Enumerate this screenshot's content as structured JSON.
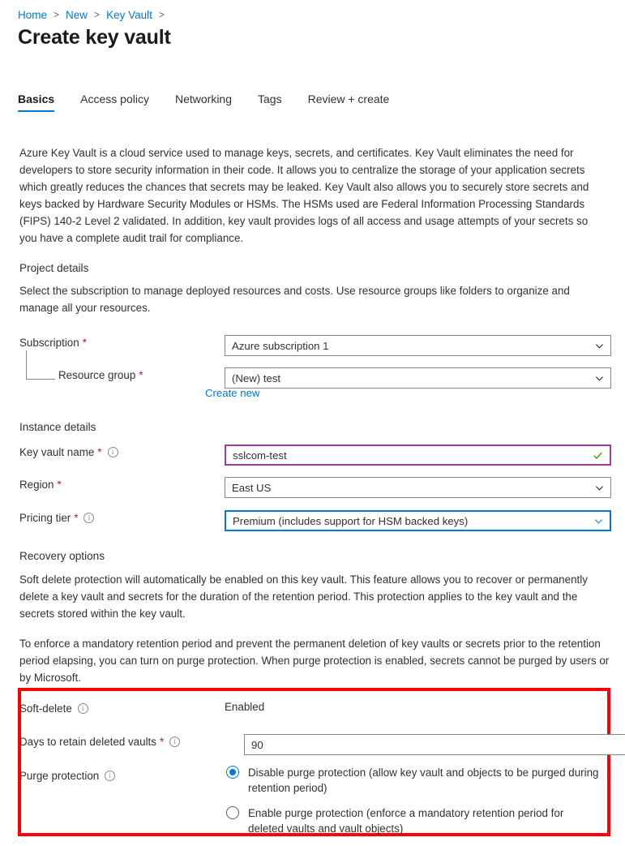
{
  "breadcrumb": {
    "items": [
      "Home",
      "New",
      "Key Vault"
    ],
    "separator": ">"
  },
  "page_title": "Create key vault",
  "tabs": [
    {
      "label": "Basics",
      "active": true
    },
    {
      "label": "Access policy",
      "active": false
    },
    {
      "label": "Networking",
      "active": false
    },
    {
      "label": "Tags",
      "active": false
    },
    {
      "label": "Review + create",
      "active": false
    }
  ],
  "intro": "Azure Key Vault is a cloud service used to manage keys, secrets, and certificates. Key Vault eliminates the need for developers to store security information in their code. It allows you to centralize the storage of your application secrets which greatly reduces the chances that secrets may be leaked. Key Vault also allows you to securely store secrets and keys backed by Hardware Security Modules or HSMs. The HSMs used are Federal Information Processing Standards (FIPS) 140-2 Level 2 validated. In addition, key vault provides logs of all access and usage attempts of your secrets so you have a complete audit trail for compliance.",
  "project_details": {
    "heading": "Project details",
    "description": "Select the subscription to manage deployed resources and costs. Use resource groups like folders to organize and manage all your resources.",
    "subscription": {
      "label": "Subscription",
      "required": "*",
      "value": "Azure subscription 1"
    },
    "resource_group": {
      "label": "Resource group",
      "required": "*",
      "value": "(New) test",
      "create_new_link": "Create new"
    }
  },
  "instance_details": {
    "heading": "Instance details",
    "key_vault_name": {
      "label": "Key vault name",
      "required": "*",
      "value": "sslcom-test"
    },
    "region": {
      "label": "Region",
      "required": "*",
      "value": "East US"
    },
    "pricing_tier": {
      "label": "Pricing tier",
      "required": "*",
      "value": "Premium (includes support for HSM backed keys)"
    }
  },
  "recovery_options": {
    "heading": "Recovery options",
    "paragraph1": "Soft delete protection will automatically be enabled on this key vault. This feature allows you to recover or permanently delete a key vault and secrets for the duration of the retention period. This protection applies to the key vault and the secrets stored within the key vault.",
    "paragraph2": "To enforce a mandatory retention period and prevent the permanent deletion of key vaults or secrets prior to the retention period elapsing, you can turn on purge protection. When purge protection is enabled, secrets cannot be purged by users or by Microsoft.",
    "soft_delete": {
      "label": "Soft-delete",
      "value": "Enabled"
    },
    "days_to_retain": {
      "label": "Days to retain deleted vaults",
      "required": "*",
      "value": "90"
    },
    "purge_protection": {
      "label": "Purge protection",
      "options": [
        {
          "label": "Disable purge protection (allow key vault and objects to be purged during retention period)",
          "selected": true
        },
        {
          "label": "Enable purge protection (enforce a mandatory retention period for deleted vaults and vault objects)",
          "selected": false
        }
      ]
    }
  },
  "colors": {
    "accent": "#0078d4",
    "required_red": "#a4262c",
    "highlight_red": "#ff0000",
    "valid_purple": "#a4389f",
    "valid_green": "#57a300"
  }
}
